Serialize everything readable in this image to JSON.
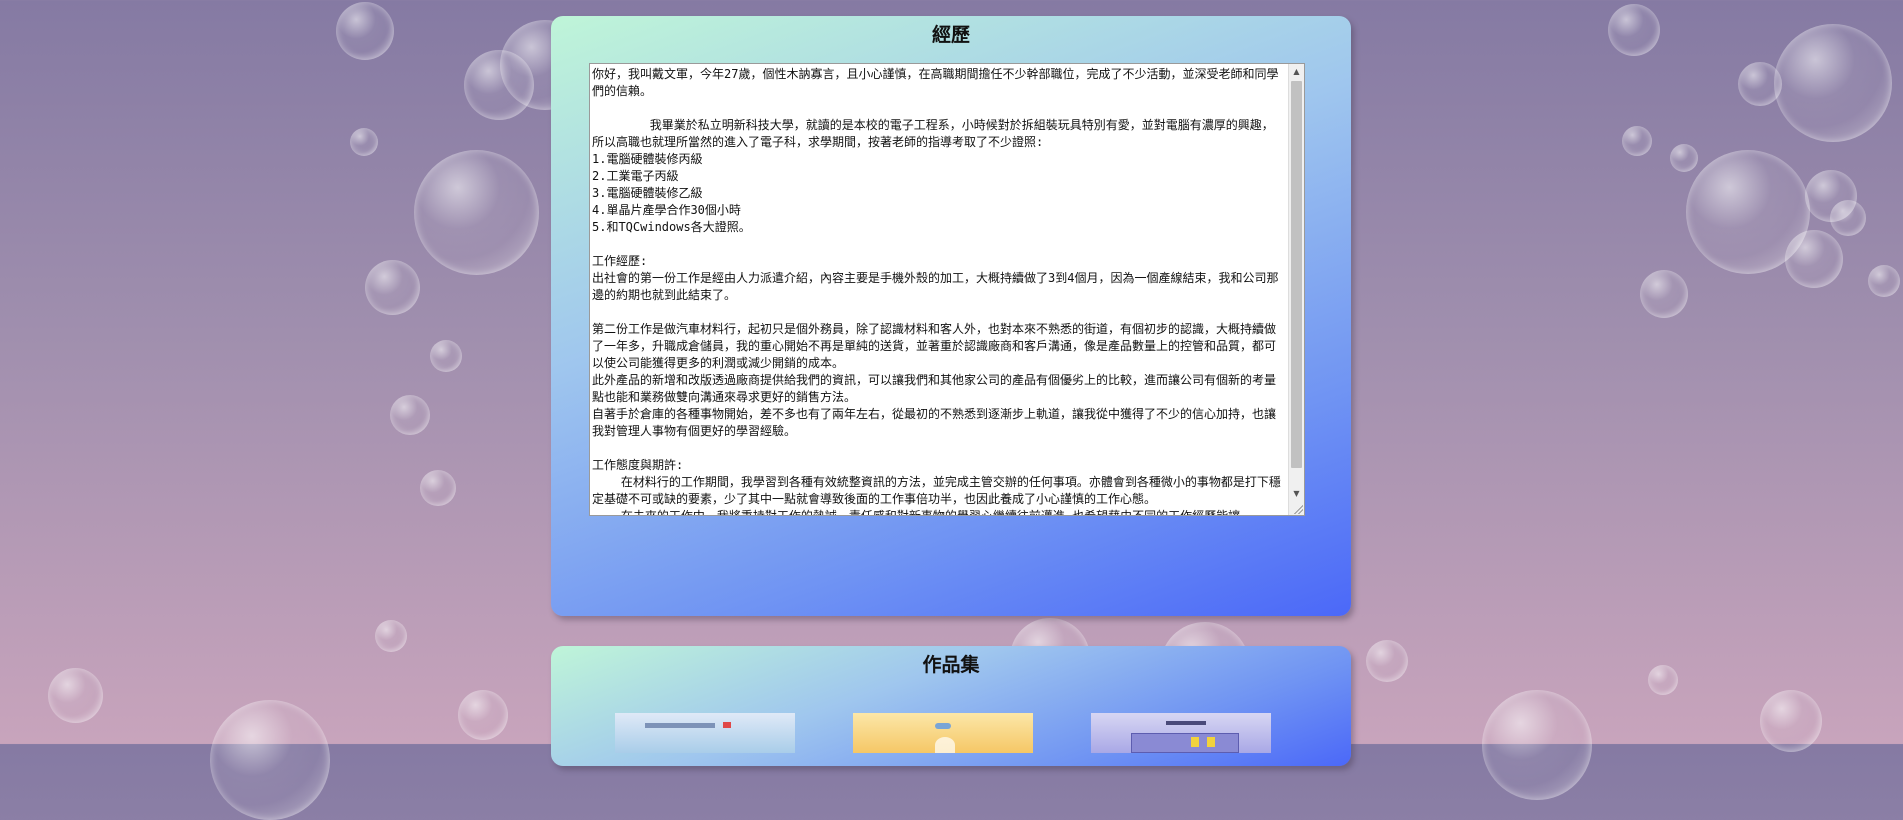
{
  "experience": {
    "title": "經歷",
    "text": "你好，我叫戴文軍，今年27歲，個性木訥寡言，且小心謹慎，在高職期間擔任不少幹部職位，完成了不少活動，並深受老師和同學們的信賴。\n\n\t我畢業於私立明新科技大學，就讀的是本校的電子工程系，小時候對於拆組裝玩具特別有愛，並對電腦有濃厚的興趣，所以高職也就理所當然的進入了電子科，求學期間，按著老師的指導考取了不少證照:\n1.電腦硬體裝修丙級\n2.工業電子丙級\n3.電腦硬體裝修乙級\n4.單晶片產學合作30個小時\n5.和TQCwindows各大證照。\n\n工作經歷:\n出社會的第一份工作是經由人力派遣介紹，內容主要是手機外殼的加工，大概持續做了3到4個月，因為一個產線結束，我和公司那邊的約期也就到此結束了。\n\n第二份工作是做汽車材料行，起初只是個外務員，除了認識材料和客人外，也對本來不熟悉的街道，有個初步的認識，大概持續做了一年多，升職成倉儲員，我的重心開始不再是單純的送貨，並著重於認識廠商和客戶溝通，像是產品數量上的控管和品質，都可以使公司能獲得更多的利潤或減少開銷的成本。\n此外產品的新增和改版透過廠商提供給我們的資訊，可以讓我們和其他家公司的產品有個優劣上的比較，進而讓公司有個新的考量點也能和業務做雙向溝通來尋求更好的銷售方法。\n自著手於倉庫的各種事物開始，差不多也有了兩年左右，從最初的不熟悉到逐漸步上軌道，讓我從中獲得了不少的信心加持，也讓我對管理人事物有個更好的學習經驗。\n\n工作態度與期許:\n    在材料行的工作期間，我學習到各種有效統整資訊的方法，並完成主管交辦的任何事項。亦體會到各種微小的事物都是打下穩定基礎不可或缺的要素，少了其中一點就會導致後面的工作事倍功半，也因此養成了小心謹慎的工作心態。\n    在未來的工作中，我將秉持對工作的熱誠、責任感和對新事物的學習心繼續往前邁進,也希望藉由不同的工作經歷能讓"
  },
  "works": {
    "title": "作品集"
  },
  "scrollbar": {
    "up_glyph": "▲",
    "down_glyph": "▼"
  }
}
